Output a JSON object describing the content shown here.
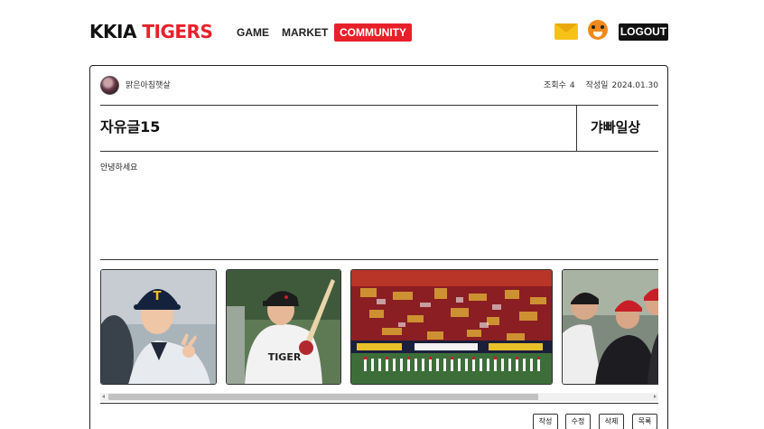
{
  "header": {
    "logo_part1": "KKIA",
    "logo_part2": "TIGERS",
    "nav": {
      "game": "GAME",
      "market": "MARKET",
      "community": "COMMUNITY"
    },
    "logout_label": "LOGOUT",
    "icons": [
      "mail-icon",
      "tiger-icon"
    ]
  },
  "post": {
    "author": "맑은아침햇살",
    "views_label": "조회수",
    "views_value": "4",
    "date_label": "작성일",
    "date_value": "2024.01.30",
    "title": "자유글15",
    "category": "갸빠일상",
    "content": "안녕하세요",
    "images": [
      "player-portrait",
      "batter-photo",
      "stadium-crowd-photo",
      "fans-photo"
    ]
  },
  "actions": {
    "write": "작성",
    "edit": "수정",
    "delete": "삭제",
    "list": "목록"
  },
  "colors": {
    "brand_red": "#e8202a",
    "text_dark": "#111111",
    "mail_yellow": "#f6c21a"
  }
}
